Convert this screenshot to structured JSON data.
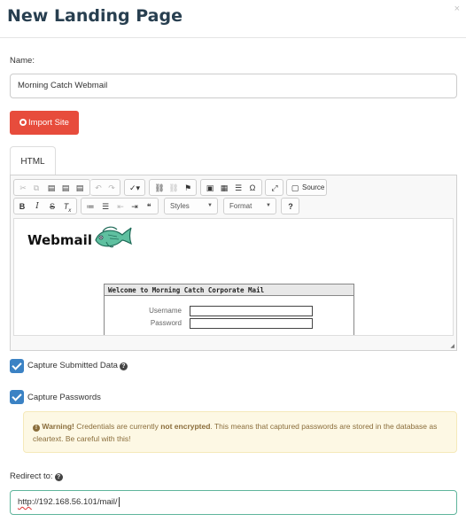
{
  "modal": {
    "title": "New Landing Page",
    "close_label": "×"
  },
  "form": {
    "name_label": "Name:",
    "name_value": "Morning Catch Webmail",
    "import_button": "Import Site",
    "tab_html": "HTML",
    "capture_data_label": "Capture Submitted Data",
    "capture_data_checked": true,
    "capture_passwords_label": "Capture Passwords",
    "capture_passwords_checked": true,
    "redirect_label": "Redirect to:",
    "redirect_value_scheme": "http",
    "redirect_value_rest": "://192.168.56.101/mail/"
  },
  "warning": {
    "icon": "!",
    "strong": "Warning!",
    "text1": " Credentials are currently ",
    "emphasis": "not encrypted",
    "text2": ". This means that captured passwords are stored in the database as cleartext. Be careful with this!"
  },
  "editor": {
    "toolbar": {
      "row1": [
        {
          "name": "cut-icon",
          "glyph": "✂",
          "dim": true
        },
        {
          "name": "copy-icon",
          "glyph": "⧉",
          "dim": true
        },
        {
          "name": "paste-icon",
          "glyph": "📋"
        },
        {
          "name": "paste-text-icon",
          "glyph": "📋"
        },
        {
          "name": "paste-word-icon",
          "glyph": "📋"
        },
        {
          "name": "undo-icon",
          "glyph": "↶",
          "dim": true
        },
        {
          "name": "redo-icon",
          "glyph": "↷",
          "dim": true
        },
        {
          "name": "spellcheck-icon",
          "glyph": "✓"
        },
        {
          "name": "link-icon",
          "glyph": "⛓"
        },
        {
          "name": "unlink-icon",
          "glyph": "⛓",
          "dim": true
        },
        {
          "name": "anchor-icon",
          "glyph": "⚑"
        },
        {
          "name": "image-icon",
          "glyph": "▣"
        },
        {
          "name": "table-icon",
          "glyph": "▦"
        },
        {
          "name": "horizontal-rule-icon",
          "glyph": "☰"
        },
        {
          "name": "special-char-icon",
          "glyph": "Ω"
        },
        {
          "name": "maximize-icon",
          "glyph": "⤢"
        },
        {
          "name": "source-icon",
          "glyph": "🗎"
        }
      ],
      "source_label": "Source",
      "row2": [
        {
          "name": "bold-icon",
          "glyph": "B"
        },
        {
          "name": "italic-icon",
          "glyph": "I"
        },
        {
          "name": "strike-icon",
          "glyph": "S"
        },
        {
          "name": "remove-format-icon",
          "glyph": "Tx"
        },
        {
          "name": "numbered-list-icon",
          "glyph": "≔"
        },
        {
          "name": "bulleted-list-icon",
          "glyph": "☰"
        },
        {
          "name": "outdent-icon",
          "glyph": "⇤",
          "dim": true
        },
        {
          "name": "indent-icon",
          "glyph": "⇥"
        },
        {
          "name": "blockquote-icon",
          "glyph": "❝"
        }
      ],
      "styles_label": "Styles",
      "format_label": "Format",
      "help_label": "?"
    },
    "content": {
      "webmail_title": "Webmail",
      "login_heading": "Welcome to Morning Catch Corporate Mail",
      "username_label": "Username",
      "password_label": "Password"
    }
  }
}
